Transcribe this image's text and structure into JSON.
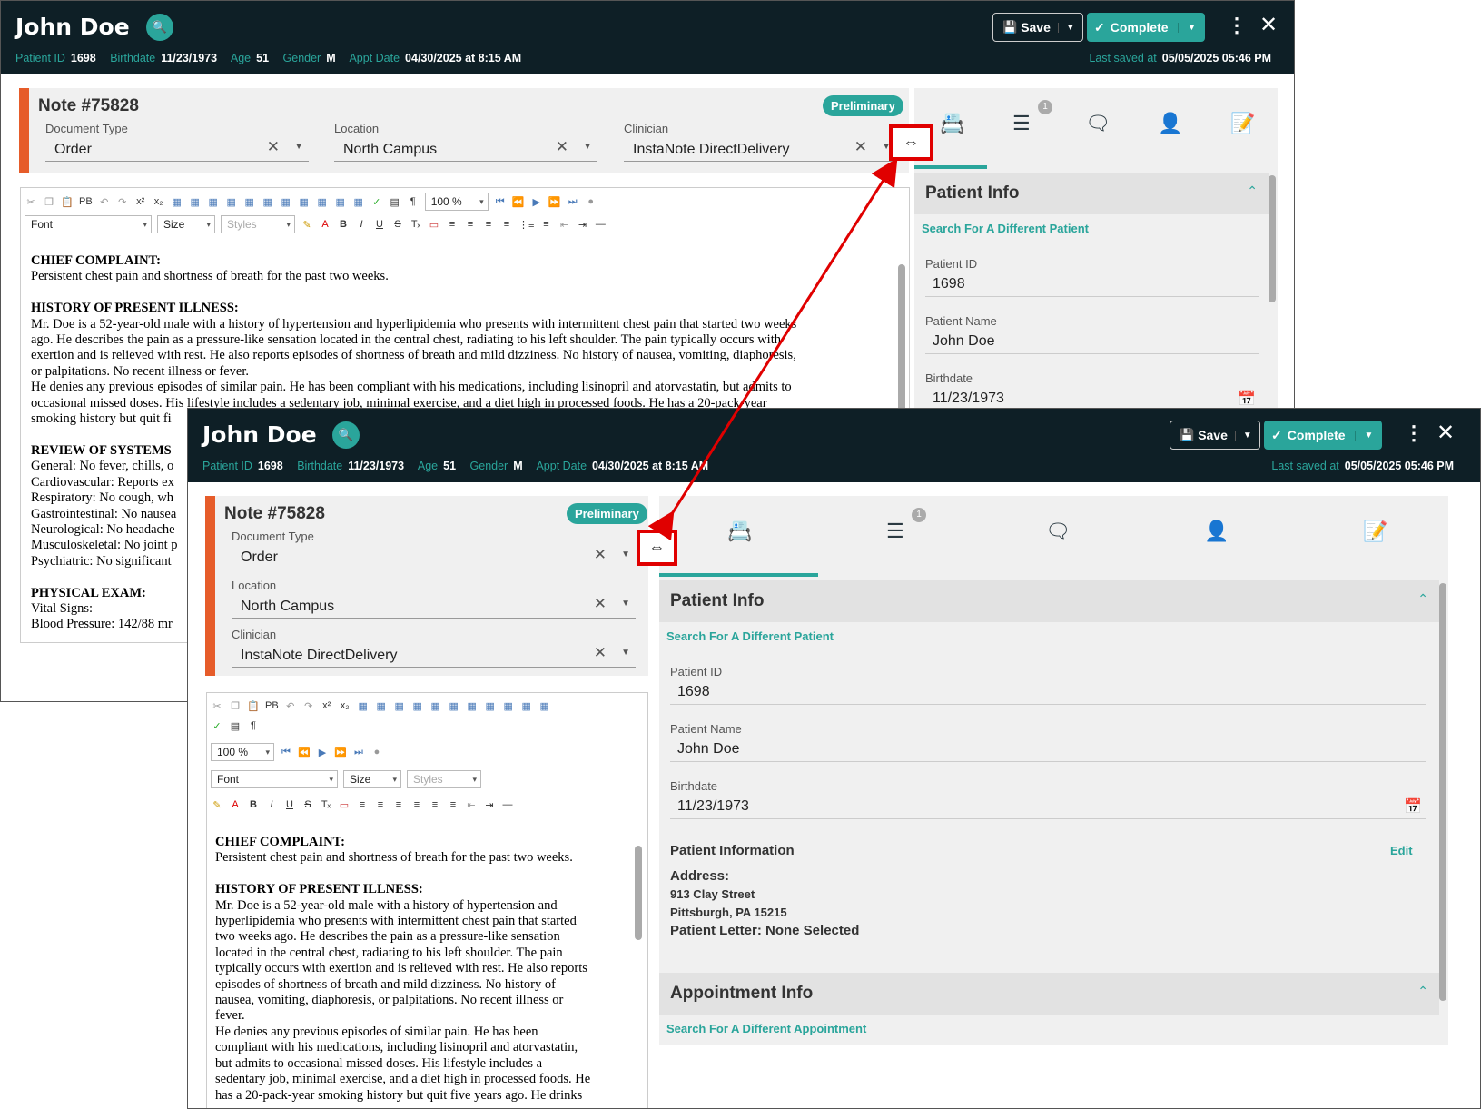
{
  "header": {
    "patient_name": "John Doe",
    "patient_id_label": "Patient ID",
    "patient_id": "1698",
    "birthdate_label": "Birthdate",
    "birthdate": "11/23/1973",
    "age_label": "Age",
    "age": "51",
    "gender_label": "Gender",
    "gender": "M",
    "appt_label": "Appt Date",
    "appt": "04/30/2025 at 8:15 AM",
    "saved_label": "Last saved at",
    "saved": "05/05/2025 05:46 PM",
    "save_label": "Save",
    "complete_label": "Complete"
  },
  "note": {
    "title": "Note #75828",
    "status": "Preliminary",
    "doc_type_label": "Document Type",
    "doc_type": "Order",
    "location_label": "Location",
    "location": "North Campus",
    "clinician_label": "Clinician",
    "clinician": "InstaNote DirectDelivery"
  },
  "toolbar": {
    "zoom": "100 %",
    "font": "Font",
    "size": "Size",
    "styles": "Styles",
    "pb": "PB"
  },
  "content1": {
    "cc_h": "CHIEF COMPLAINT:",
    "cc": "Persistent chest pain and shortness of breath for the past two weeks.",
    "hpi_h": "HISTORY OF PRESENT ILLNESS:",
    "hpi_l1": "Mr. Doe is a 52-year-old male with a history of hypertension and hyperlipidemia who presents with intermittent chest pain that started two weeks",
    "hpi_l2": "ago. He describes the pain as a pressure-like sensation located in the central chest, radiating to his left shoulder. The pain typically occurs with",
    "hpi_l3": "exertion and is relieved with rest. He also reports episodes of shortness of breath and mild dizziness. No history of nausea, vomiting, diaphoresis,",
    "hpi_l4": "or palpitations. No recent illness or fever.",
    "hpi_l5": "He denies any previous episodes of similar pain. He has been compliant with his medications, including lisinopril and atorvastatin, but admits to",
    "hpi_l6": "occasional missed doses. His lifestyle includes a sedentary job, minimal exercise, and a diet high in processed foods. He has a 20-pack-year",
    "hpi_l7": "smoking history but quit fi",
    "ros_h": "REVIEW OF SYSTEMS",
    "ros_1": "General: No fever, chills, o",
    "ros_2": "Cardiovascular: Reports ex",
    "ros_3": "Respiratory: No cough, wh",
    "ros_4": "Gastrointestinal: No nausea",
    "ros_5": "Neurological: No headache",
    "ros_6": "Musculoskeletal: No joint p",
    "ros_7": "Psychiatric: No significant",
    "pe_h": "PHYSICAL EXAM:",
    "pe_1": "Vital Signs:",
    "pe_2": "Blood Pressure: 142/88 mr"
  },
  "content2": {
    "cc_h": "CHIEF COMPLAINT:",
    "cc": "Persistent chest pain and shortness of breath for the past two weeks.",
    "hpi_h": "HISTORY OF PRESENT ILLNESS:",
    "l1": "Mr. Doe is a 52-year-old male with a history of hypertension and",
    "l2": "hyperlipidemia who presents with intermittent chest pain that started",
    "l3": "two weeks ago. He describes the pain as a pressure-like sensation",
    "l4": "located in the central chest, radiating to his left shoulder. The pain",
    "l5": "typically occurs with exertion and is relieved with rest. He also reports",
    "l6": "episodes of shortness of breath and mild dizziness. No history of",
    "l7": "nausea, vomiting, diaphoresis, or palpitations. No recent illness or",
    "l8": "fever.",
    "l9": "He denies any previous episodes of similar pain. He has been",
    "l10": "compliant with his medications, including lisinopril and atorvastatin,",
    "l11": "but admits to occasional missed doses. His lifestyle includes a",
    "l12": "sedentary job, minimal exercise, and a diet high in processed foods. He",
    "l13": "has a 20-pack-year smoking history but quit five years ago. He drinks"
  },
  "right": {
    "tab_badge": "1",
    "patient_info_title": "Patient Info",
    "search_patient": "Search For A Different Patient",
    "patient_id_label": "Patient ID",
    "patient_id": "1698",
    "patient_name_label": "Patient Name",
    "patient_name": "John Doe",
    "birthdate_label": "Birthdate",
    "birthdate": "11/23/1973",
    "patient_information": "Patient Information",
    "edit": "Edit",
    "address_label": "Address:",
    "address_1": "913 Clay Street",
    "address_2": "Pittsburgh, PA 15215",
    "letter": "Patient Letter: None Selected",
    "appt_info_title": "Appointment Info",
    "search_appt": "Search For A Different Appointment"
  },
  "colors": {
    "header_bg": "#0e1f26",
    "accent_teal": "#2aa59b",
    "note_accent": "#e65c2a",
    "highlight_red": "#e00000"
  },
  "icons": [
    "user-search-icon",
    "save-icon",
    "complete-icon",
    "more-vert-icon",
    "close-icon",
    "patient-card-icon",
    "list-icon",
    "chat-icon",
    "person-icon",
    "edit-doc-icon",
    "resize-handle-icon",
    "calendar-icon"
  ]
}
